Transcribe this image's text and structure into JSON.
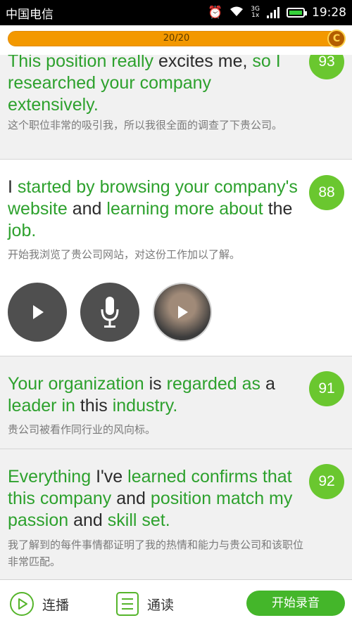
{
  "status_bar": {
    "carrier": "中国电信",
    "network": "3G",
    "network2": "1x",
    "time": "19:28"
  },
  "progress": {
    "text": "20/20",
    "value_fraction": 1.0
  },
  "cards": [
    {
      "words": [
        {
          "t": "This position really ",
          "g": true
        },
        {
          "t": "excites me, ",
          "g": false
        },
        {
          "t": "so I researched your company extensively.",
          "g": true
        }
      ],
      "translation": "这个职位非常的吸引我，所以我很全面的调查了下贵公司。",
      "score": "93"
    },
    {
      "words": [
        {
          "t": "I ",
          "g": false
        },
        {
          "t": "started by browsing your company's website ",
          "g": true
        },
        {
          "t": "and ",
          "g": false
        },
        {
          "t": "learning more about ",
          "g": true
        },
        {
          "t": "the ",
          "g": false
        },
        {
          "t": "job.",
          "g": true
        }
      ],
      "translation": "开始我浏览了贵公司网站，对这份工作加以了解。",
      "score": "88"
    },
    {
      "words": [
        {
          "t": "Your organization ",
          "g": true
        },
        {
          "t": "is ",
          "g": false
        },
        {
          "t": "regarded as ",
          "g": true
        },
        {
          "t": "a ",
          "g": false
        },
        {
          "t": "leader in ",
          "g": true
        },
        {
          "t": "this ",
          "g": false
        },
        {
          "t": "industry.",
          "g": true
        }
      ],
      "translation": "贵公司被看作同行业的风向标。",
      "score": "91"
    },
    {
      "words": [
        {
          "t": "Everything ",
          "g": true
        },
        {
          "t": "I've ",
          "g": false
        },
        {
          "t": "learned confirms that this company ",
          "g": true
        },
        {
          "t": "and ",
          "g": false
        },
        {
          "t": "position match my passion ",
          "g": true
        },
        {
          "t": "and ",
          "g": false
        },
        {
          "t": "skill set.",
          "g": true
        }
      ],
      "translation": "我了解到的每件事情都证明了我的热情和能力与贵公司和该职位非常匹配。",
      "score": "92"
    }
  ],
  "bottom_bar": {
    "continuous_play": "连播",
    "read_along": "通读",
    "record": "开始录音"
  },
  "colors": {
    "green_text": "#2da12d",
    "score_green": "#6ac72f",
    "progress_orange": "#f39800"
  },
  "icons": [
    "play-icon",
    "microphone-icon",
    "user-avatar-play-icon",
    "play-circle-icon",
    "list-icon"
  ]
}
